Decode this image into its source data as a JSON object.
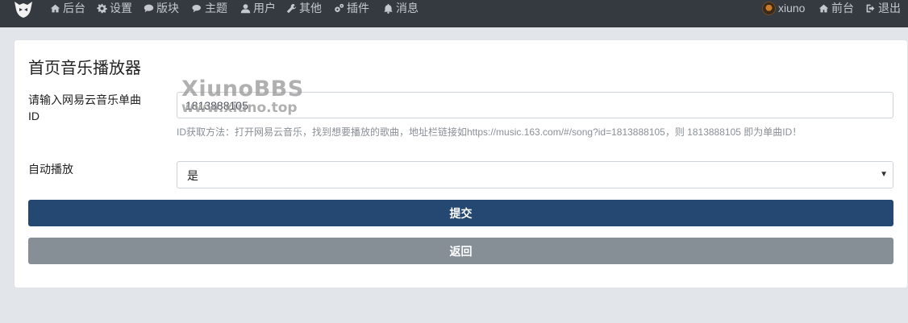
{
  "navbar": {
    "left_items": [
      {
        "label": "后台",
        "icon": "home-icon"
      },
      {
        "label": "设置",
        "icon": "gear-icon"
      },
      {
        "label": "版块",
        "icon": "comment-icon"
      },
      {
        "label": "主题",
        "icon": "comments-icon"
      },
      {
        "label": "用户",
        "icon": "user-icon"
      },
      {
        "label": "其他",
        "icon": "wrench-icon"
      },
      {
        "label": "插件",
        "icon": "cogs-icon"
      },
      {
        "label": "消息",
        "icon": "bell-icon"
      }
    ],
    "username": "xiuno",
    "front_label": "前台",
    "logout_label": "退出"
  },
  "card": {
    "title": "首页音乐播放器",
    "song_id_label": "请输入网易云音乐单曲ID",
    "song_id_value": "1813888105",
    "song_id_hint": "ID获取方法：打开网易云音乐，找到想要播放的歌曲，地址栏链接如https://music.163.com/#/song?id=1813888105，则 1813888105 即为单曲ID！",
    "autoplay_label": "自动播放",
    "autoplay_value": "是",
    "submit_label": "提交",
    "back_label": "返回"
  },
  "watermark": {
    "line1": "XiunoBBS",
    "line2": "www.xiuno.top"
  }
}
